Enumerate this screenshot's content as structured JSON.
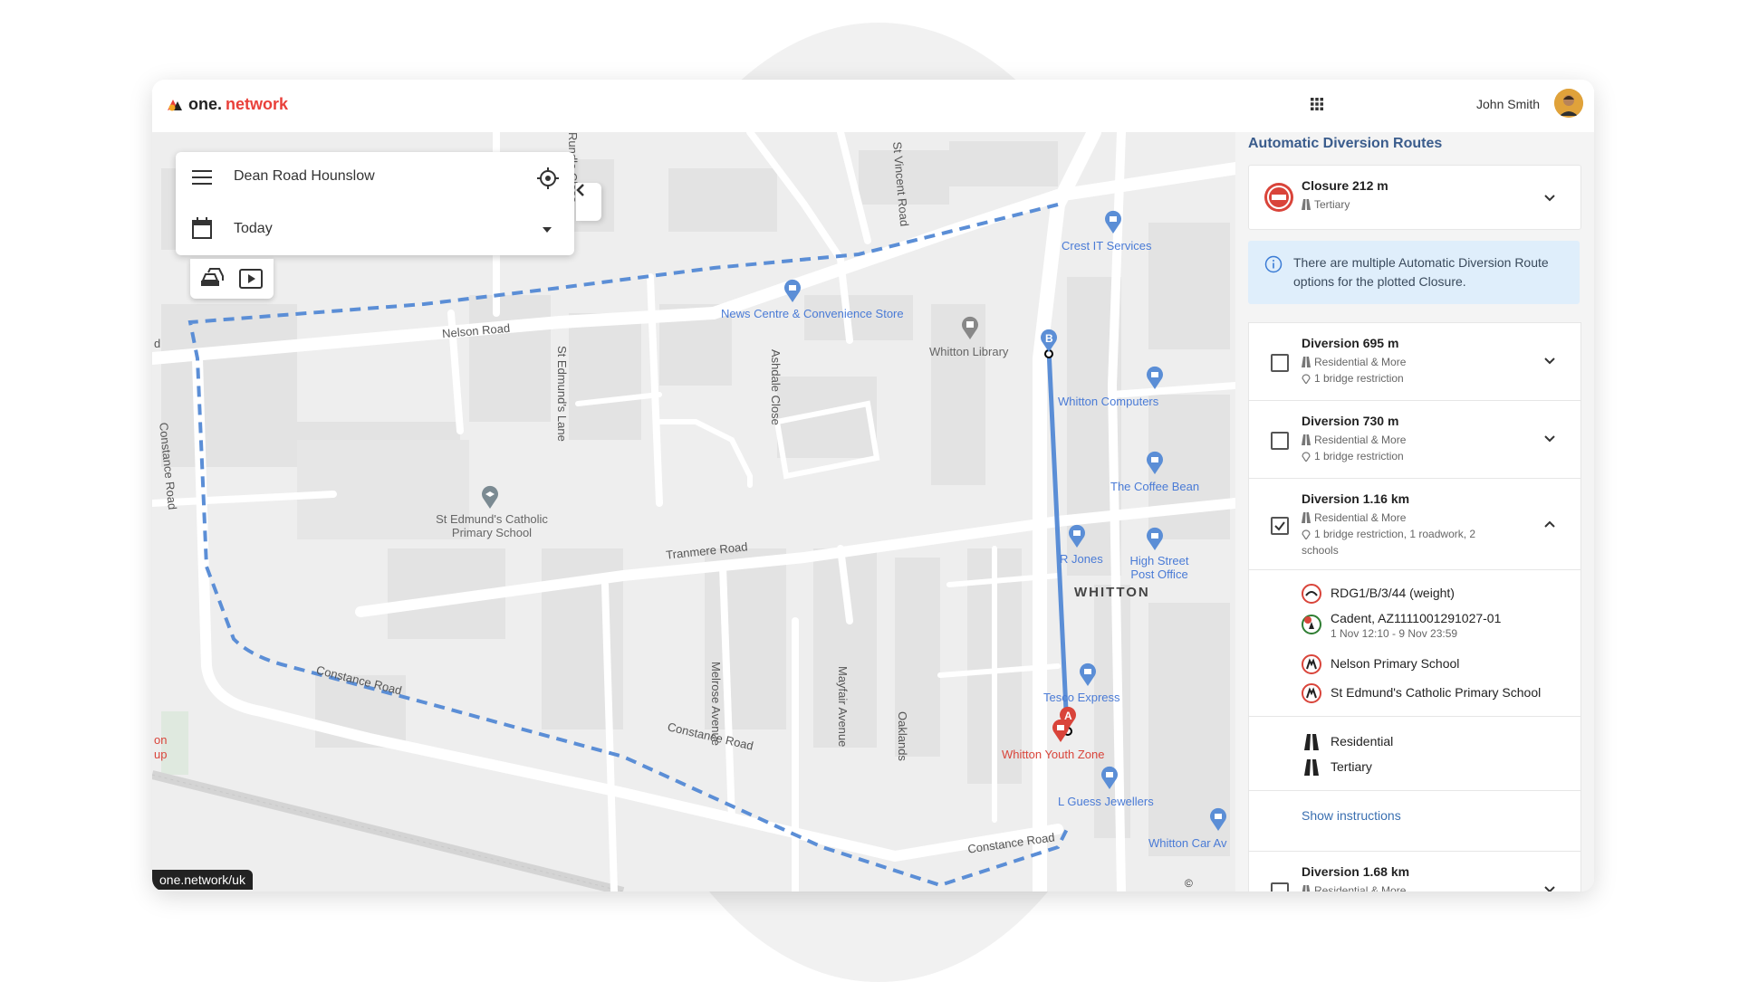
{
  "header": {
    "logo_part1": "one.",
    "logo_part2": "network",
    "user_name": "John Smith"
  },
  "search": {
    "location": "Dean Road Hounslow",
    "date": "Today"
  },
  "map": {
    "streets": [
      "Nelson Road",
      "Constance Road",
      "Constance Road",
      "Constance Road",
      "Tranmere Road",
      "Melrose Avenue",
      "Mayfair Avenue",
      "Oaklands",
      "Ashdale Close",
      "St Edmund's Lane",
      "St Vincent Road",
      "Rundle Close"
    ],
    "area_label": "WHITTON",
    "places": {
      "library": "Whitton Library",
      "school": "St Edmund's Catholic Primary School",
      "news": "News Centre & Convenience Store",
      "crest": "Crest IT Services",
      "computers": "Whitton Computers",
      "coffee": "The Coffee Bean",
      "rjones": "R Jones",
      "post": "High Street Post Office",
      "tesco": "Tesco Express",
      "youth": "Whitton Youth Zone",
      "jewellers": "L Guess Jewellers",
      "carav": "Whitton Car Av"
    },
    "edge_labels": {
      "left_d": "d",
      "on": "on",
      "up": "up"
    },
    "marker_a": "A",
    "marker_b": "B",
    "attribution": "one.network/uk",
    "maptiler": "© MapTiler"
  },
  "panel": {
    "title": "Automatic Diversion Routes",
    "closure": {
      "title": "Closure 212 m",
      "road_type": "Tertiary"
    },
    "info": "There are multiple Automatic Diversion Route options for the plotted Closure.",
    "diversions": [
      {
        "title": "Diversion 695 m",
        "type": "Residential & More",
        "restriction": "1 bridge restriction",
        "checked": false
      },
      {
        "title": "Diversion 730 m",
        "type": "Residential & More",
        "restriction": "1 bridge restriction",
        "checked": false
      },
      {
        "title": "Diversion 1.16 km",
        "type": "Residential & More",
        "restriction_line1": "1 bridge restriction, 1 roadwork, 2",
        "restriction_line2": "schools",
        "checked": true
      },
      {
        "title": "Diversion 1.68 km",
        "type": "Residential & More",
        "checked": false
      }
    ],
    "details": {
      "weight": "RDG1/B/3/44 (weight)",
      "roadwork": "Cadent, AZ1111001291027-01",
      "roadwork_dates": "1 Nov 12:10 - 9 Nov 23:59",
      "school1": "Nelson Primary School",
      "school2": "St Edmund's Catholic Primary School",
      "road1": "Residential",
      "road2": "Tertiary",
      "show_instructions": "Show instructions"
    }
  },
  "colors": {
    "route_blue": "#5b8ed6",
    "closure_red": "#d9443a",
    "brand_red": "#e9403a"
  }
}
